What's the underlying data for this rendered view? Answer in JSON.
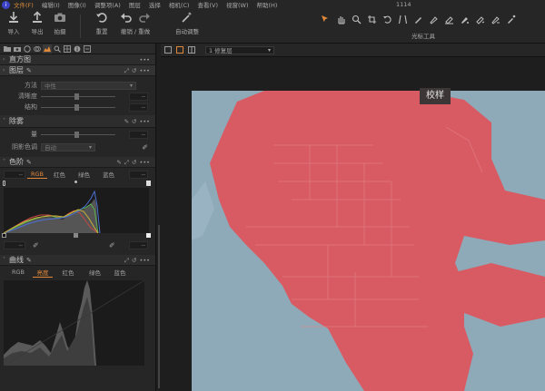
{
  "menubar": {
    "items": [
      "文件(F)",
      "编辑(I)",
      "图像(I)",
      "调整项(A)",
      "图层",
      "选择",
      "相机(C)",
      "查看(V)",
      "视窗(W)",
      "帮助(H)"
    ],
    "active_index": 0,
    "doc_title": "1114"
  },
  "toolbar": {
    "import": "导入",
    "export": "导出",
    "capture": "拍摄",
    "reset": "重置",
    "undo_redo": "撤销 / 重做",
    "auto_adjust": "自动调整",
    "cursor_tools": "光标工具"
  },
  "panel": {
    "histogram_title": "直方图",
    "layers_title": "图层",
    "method_label": "方法",
    "method_value": "中性",
    "clarity_label": "清晰度",
    "structure_label": "结构",
    "dehaze_title": "除雾",
    "amount_label": "量",
    "shadow_tone_label": "阴影色调",
    "shadow_tone_value": "自动",
    "levels_title": "色阶",
    "levels_tabs": [
      "RGB",
      "红色",
      "绿色",
      "蓝色"
    ],
    "levels_active": 0,
    "curves_title": "曲线",
    "curves_tabs": [
      "RGB",
      "亮度",
      "红色",
      "绿色",
      "蓝色"
    ],
    "curves_active": 1,
    "num_placeholder": "--"
  },
  "viewer": {
    "layer_select": "1 修复层",
    "proof_label": "校样"
  },
  "colors": {
    "accent": "#e0893a",
    "photo_bg": "#8eaab8",
    "mask": "#d85a63"
  }
}
